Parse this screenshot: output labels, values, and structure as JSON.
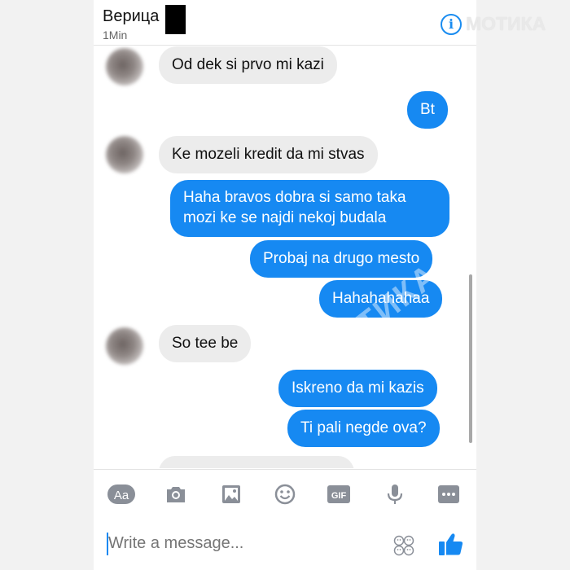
{
  "header": {
    "contact_name": "Верица",
    "status": "1Min",
    "info_icon": "info-icon",
    "watermark": "МОТИКА"
  },
  "messages": [
    {
      "side": "in",
      "text": "Od dek si prvo mi kazi"
    },
    {
      "side": "out",
      "text": "Bt"
    },
    {
      "side": "in",
      "text": "Ke mozeli kredit da mi stvas"
    },
    {
      "side": "out",
      "text": "Haha bravos dobra si samo taka mozi ke se najdi nekoj budala"
    },
    {
      "side": "out",
      "text": "Probaj na drugo mesto"
    },
    {
      "side": "out",
      "text": "Hahahahahaa"
    },
    {
      "side": "in",
      "text": "So tee be"
    },
    {
      "side": "out",
      "text": "Iskreno da mi kazis"
    },
    {
      "side": "out",
      "text": "Ti pali negde ova?"
    }
  ],
  "chat_watermark": "МОТИКА",
  "toolbar": {
    "icons": [
      "text-size-icon",
      "camera-icon",
      "gallery-icon",
      "emoji-icon",
      "gif-icon",
      "microphone-icon",
      "more-icon"
    ],
    "aa_label": "Aa",
    "gif_label": "GIF"
  },
  "composer": {
    "placeholder": "Write a message...",
    "emoji_icon": "emoji-grid-icon",
    "like_icon": "thumbs-up-icon"
  },
  "colors": {
    "accent": "#1689f2",
    "incoming_bubble": "#ececec",
    "outgoing_text": "#ffffff"
  }
}
